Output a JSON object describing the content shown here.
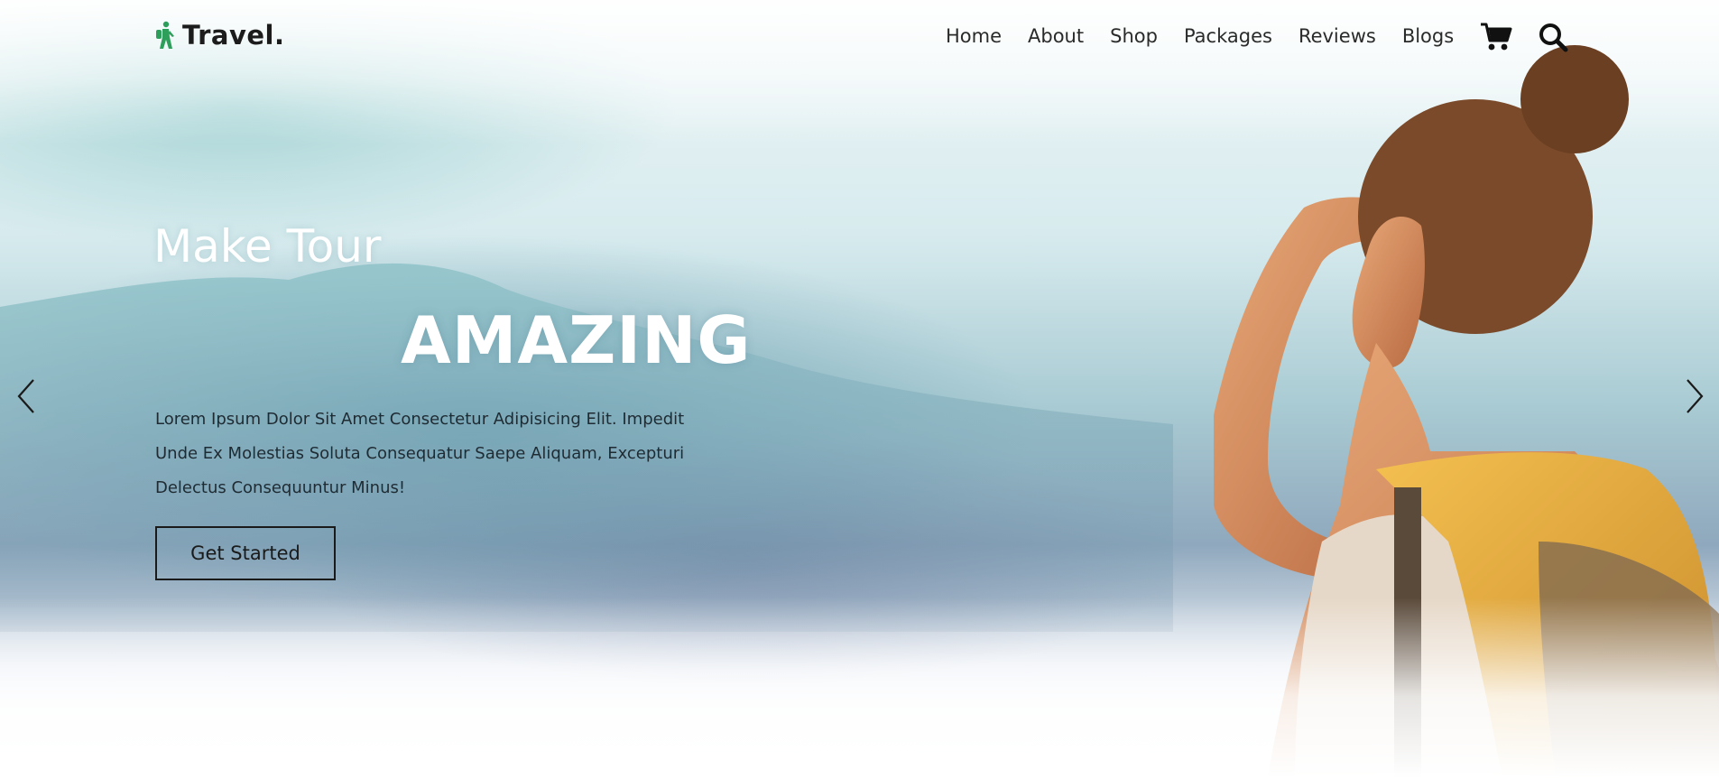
{
  "brand": {
    "name": "Travel.",
    "icon": "hiker-icon",
    "accent_color": "#2e9e5b"
  },
  "nav": {
    "items": [
      {
        "label": "Home"
      },
      {
        "label": "About"
      },
      {
        "label": "Shop"
      },
      {
        "label": "Packages"
      },
      {
        "label": "Reviews"
      },
      {
        "label": "Blogs"
      }
    ],
    "cart_icon": "shopping-cart-icon",
    "search_icon": "search-icon"
  },
  "hero": {
    "subtitle": "Make Tour",
    "title": "AMAZING",
    "description_lines": [
      "Lorem Ipsum Dolor Sit Amet Consectetur Adipisicing Elit. Impedit",
      "Unde Ex Molestias Soluta Consequatur Saepe Aliquam, Excepturi",
      "Delectus Consequuntur Minus!"
    ],
    "cta_label": "Get Started",
    "prev_icon": "chevron-left-icon",
    "next_icon": "chevron-right-icon"
  }
}
